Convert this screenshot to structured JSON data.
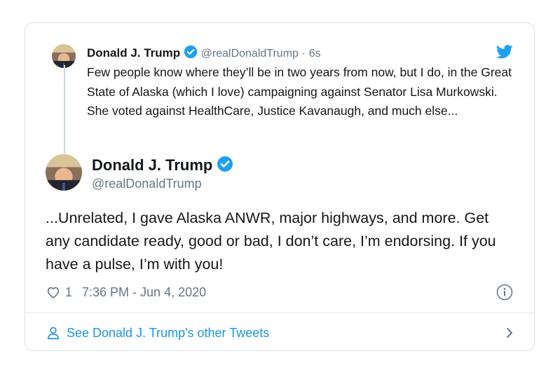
{
  "quoted_tweet": {
    "name": "Donald J. Trump",
    "handle": "@realDonaldTrump",
    "separator": "·",
    "time": "6s",
    "text": "Few people know where they’ll be in two years from now, but I do, in the Great State of Alaska (which I love) campaigning against Senator Lisa Murkowski. She voted against HealthCare, Justice Kavanaugh, and much else..."
  },
  "tweet": {
    "name": "Donald J. Trump",
    "handle": "@realDonaldTrump",
    "text": "...Unrelated, I gave Alaska ANWR, major highways, and more. Get any candidate ready, good or bad, I don’t care, I’m endorsing. If you have a pulse, I’m with you!",
    "like_count": "1",
    "timestamp": "7:36 PM - Jun 4, 2020"
  },
  "footer": {
    "label": "See Donald J. Trump's other Tweets"
  },
  "icons": {
    "brand": "twitter-bird-icon",
    "verified": "verified-badge-icon",
    "like": "heart-icon",
    "info": "info-icon",
    "profile": "person-icon",
    "chevron": "chevron-right-icon"
  },
  "colors": {
    "brand": "#1da1f2",
    "link": "#1b95e0",
    "secondary_text": "#657786",
    "border": "#dadfe3"
  }
}
